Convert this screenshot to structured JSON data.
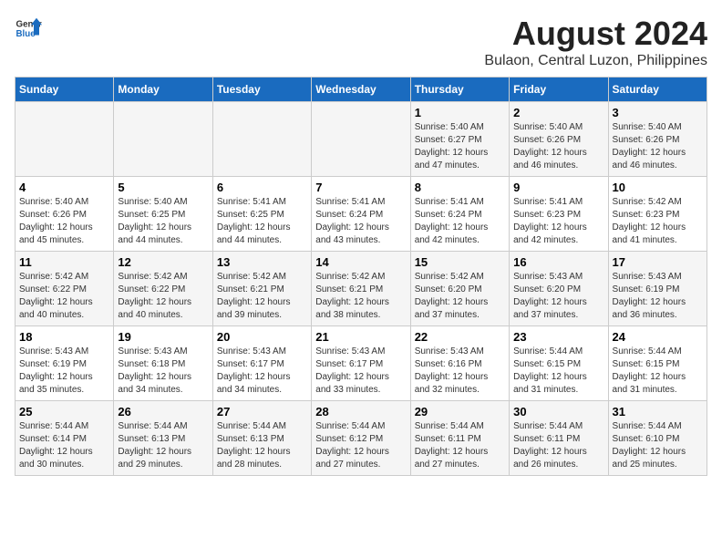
{
  "logo": {
    "general": "General",
    "blue": "Blue"
  },
  "title": "August 2024",
  "subtitle": "Bulaon, Central Luzon, Philippines",
  "weekdays": [
    "Sunday",
    "Monday",
    "Tuesday",
    "Wednesday",
    "Thursday",
    "Friday",
    "Saturday"
  ],
  "weeks": [
    [
      {
        "day": "",
        "info": ""
      },
      {
        "day": "",
        "info": ""
      },
      {
        "day": "",
        "info": ""
      },
      {
        "day": "",
        "info": ""
      },
      {
        "day": "1",
        "info": "Sunrise: 5:40 AM\nSunset: 6:27 PM\nDaylight: 12 hours\nand 47 minutes."
      },
      {
        "day": "2",
        "info": "Sunrise: 5:40 AM\nSunset: 6:26 PM\nDaylight: 12 hours\nand 46 minutes."
      },
      {
        "day": "3",
        "info": "Sunrise: 5:40 AM\nSunset: 6:26 PM\nDaylight: 12 hours\nand 46 minutes."
      }
    ],
    [
      {
        "day": "4",
        "info": "Sunrise: 5:40 AM\nSunset: 6:26 PM\nDaylight: 12 hours\nand 45 minutes."
      },
      {
        "day": "5",
        "info": "Sunrise: 5:40 AM\nSunset: 6:25 PM\nDaylight: 12 hours\nand 44 minutes."
      },
      {
        "day": "6",
        "info": "Sunrise: 5:41 AM\nSunset: 6:25 PM\nDaylight: 12 hours\nand 44 minutes."
      },
      {
        "day": "7",
        "info": "Sunrise: 5:41 AM\nSunset: 6:24 PM\nDaylight: 12 hours\nand 43 minutes."
      },
      {
        "day": "8",
        "info": "Sunrise: 5:41 AM\nSunset: 6:24 PM\nDaylight: 12 hours\nand 42 minutes."
      },
      {
        "day": "9",
        "info": "Sunrise: 5:41 AM\nSunset: 6:23 PM\nDaylight: 12 hours\nand 42 minutes."
      },
      {
        "day": "10",
        "info": "Sunrise: 5:42 AM\nSunset: 6:23 PM\nDaylight: 12 hours\nand 41 minutes."
      }
    ],
    [
      {
        "day": "11",
        "info": "Sunrise: 5:42 AM\nSunset: 6:22 PM\nDaylight: 12 hours\nand 40 minutes."
      },
      {
        "day": "12",
        "info": "Sunrise: 5:42 AM\nSunset: 6:22 PM\nDaylight: 12 hours\nand 40 minutes."
      },
      {
        "day": "13",
        "info": "Sunrise: 5:42 AM\nSunset: 6:21 PM\nDaylight: 12 hours\nand 39 minutes."
      },
      {
        "day": "14",
        "info": "Sunrise: 5:42 AM\nSunset: 6:21 PM\nDaylight: 12 hours\nand 38 minutes."
      },
      {
        "day": "15",
        "info": "Sunrise: 5:42 AM\nSunset: 6:20 PM\nDaylight: 12 hours\nand 37 minutes."
      },
      {
        "day": "16",
        "info": "Sunrise: 5:43 AM\nSunset: 6:20 PM\nDaylight: 12 hours\nand 37 minutes."
      },
      {
        "day": "17",
        "info": "Sunrise: 5:43 AM\nSunset: 6:19 PM\nDaylight: 12 hours\nand 36 minutes."
      }
    ],
    [
      {
        "day": "18",
        "info": "Sunrise: 5:43 AM\nSunset: 6:19 PM\nDaylight: 12 hours\nand 35 minutes."
      },
      {
        "day": "19",
        "info": "Sunrise: 5:43 AM\nSunset: 6:18 PM\nDaylight: 12 hours\nand 34 minutes."
      },
      {
        "day": "20",
        "info": "Sunrise: 5:43 AM\nSunset: 6:17 PM\nDaylight: 12 hours\nand 34 minutes."
      },
      {
        "day": "21",
        "info": "Sunrise: 5:43 AM\nSunset: 6:17 PM\nDaylight: 12 hours\nand 33 minutes."
      },
      {
        "day": "22",
        "info": "Sunrise: 5:43 AM\nSunset: 6:16 PM\nDaylight: 12 hours\nand 32 minutes."
      },
      {
        "day": "23",
        "info": "Sunrise: 5:44 AM\nSunset: 6:15 PM\nDaylight: 12 hours\nand 31 minutes."
      },
      {
        "day": "24",
        "info": "Sunrise: 5:44 AM\nSunset: 6:15 PM\nDaylight: 12 hours\nand 31 minutes."
      }
    ],
    [
      {
        "day": "25",
        "info": "Sunrise: 5:44 AM\nSunset: 6:14 PM\nDaylight: 12 hours\nand 30 minutes."
      },
      {
        "day": "26",
        "info": "Sunrise: 5:44 AM\nSunset: 6:13 PM\nDaylight: 12 hours\nand 29 minutes."
      },
      {
        "day": "27",
        "info": "Sunrise: 5:44 AM\nSunset: 6:13 PM\nDaylight: 12 hours\nand 28 minutes."
      },
      {
        "day": "28",
        "info": "Sunrise: 5:44 AM\nSunset: 6:12 PM\nDaylight: 12 hours\nand 27 minutes."
      },
      {
        "day": "29",
        "info": "Sunrise: 5:44 AM\nSunset: 6:11 PM\nDaylight: 12 hours\nand 27 minutes."
      },
      {
        "day": "30",
        "info": "Sunrise: 5:44 AM\nSunset: 6:11 PM\nDaylight: 12 hours\nand 26 minutes."
      },
      {
        "day": "31",
        "info": "Sunrise: 5:44 AM\nSunset: 6:10 PM\nDaylight: 12 hours\nand 25 minutes."
      }
    ]
  ]
}
